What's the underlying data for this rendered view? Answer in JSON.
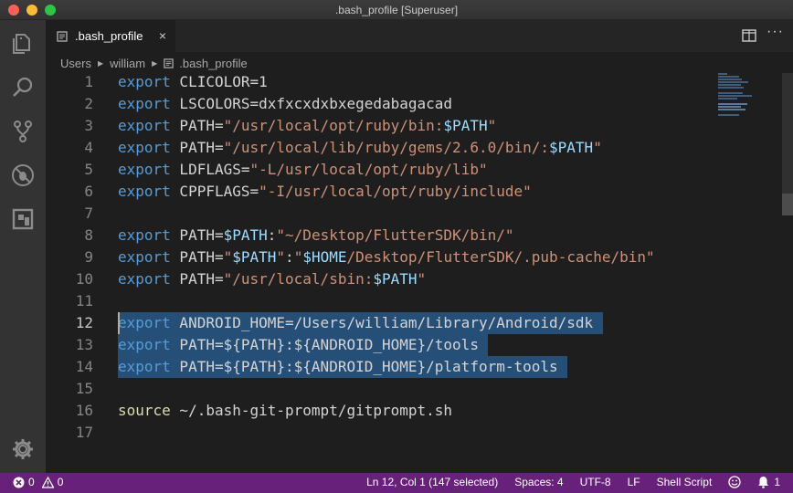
{
  "window": {
    "title": ".bash_profile [Superuser]"
  },
  "tabs": [
    {
      "label": ".bash_profile",
      "close_glyph": "×"
    }
  ],
  "breadcrumb": {
    "items": [
      "Users",
      "william",
      ".bash_profile"
    ]
  },
  "editor": {
    "lines": [
      {
        "num": "1",
        "tokens": [
          [
            "kw",
            "export"
          ],
          [
            "plain",
            " CLICOLOR=1"
          ]
        ]
      },
      {
        "num": "2",
        "tokens": [
          [
            "kw",
            "export"
          ],
          [
            "plain",
            " LSCOLORS=dxfxcxdxbxegedabagacad"
          ]
        ]
      },
      {
        "num": "3",
        "tokens": [
          [
            "kw",
            "export"
          ],
          [
            "plain",
            " PATH="
          ],
          [
            "str",
            "\"/usr/local/opt/ruby/bin:"
          ],
          [
            "var",
            "$PATH"
          ],
          [
            "str",
            "\""
          ]
        ]
      },
      {
        "num": "4",
        "tokens": [
          [
            "kw",
            "export"
          ],
          [
            "plain",
            " PATH="
          ],
          [
            "str",
            "\"/usr/local/lib/ruby/gems/2.6.0/bin/:"
          ],
          [
            "var",
            "$PATH"
          ],
          [
            "str",
            "\""
          ]
        ]
      },
      {
        "num": "5",
        "tokens": [
          [
            "kw",
            "export"
          ],
          [
            "plain",
            " LDFLAGS="
          ],
          [
            "str",
            "\"-L/usr/local/opt/ruby/lib\""
          ]
        ]
      },
      {
        "num": "6",
        "tokens": [
          [
            "kw",
            "export"
          ],
          [
            "plain",
            " CPPFLAGS="
          ],
          [
            "str",
            "\"-I/usr/local/opt/ruby/include\""
          ]
        ]
      },
      {
        "num": "7",
        "tokens": []
      },
      {
        "num": "8",
        "tokens": [
          [
            "kw",
            "export"
          ],
          [
            "plain",
            " PATH="
          ],
          [
            "var",
            "$PATH"
          ],
          [
            "plain",
            ":"
          ],
          [
            "str",
            "\"~/Desktop/FlutterSDK/bin/\""
          ]
        ]
      },
      {
        "num": "9",
        "tokens": [
          [
            "kw",
            "export"
          ],
          [
            "plain",
            " PATH="
          ],
          [
            "str",
            "\""
          ],
          [
            "var",
            "$PATH"
          ],
          [
            "str",
            "\""
          ],
          [
            "plain",
            ":"
          ],
          [
            "str",
            "\""
          ],
          [
            "var",
            "$HOME"
          ],
          [
            "str",
            "/Desktop/FlutterSDK/.pub-cache/bin\""
          ]
        ]
      },
      {
        "num": "10",
        "tokens": [
          [
            "kw",
            "export"
          ],
          [
            "plain",
            " PATH="
          ],
          [
            "str",
            "\"/usr/local/sbin:"
          ],
          [
            "var",
            "$PATH"
          ],
          [
            "str",
            "\""
          ]
        ]
      },
      {
        "num": "11",
        "tokens": []
      },
      {
        "num": "12",
        "tokens": [
          [
            "kw",
            "export"
          ],
          [
            "plain",
            " ANDROID_HOME=/Users/william/Library/Android/sdk"
          ]
        ]
      },
      {
        "num": "13",
        "tokens": [
          [
            "kw",
            "export"
          ],
          [
            "plain",
            " PATH=${PATH}:${ANDROID_HOME}/tools"
          ]
        ]
      },
      {
        "num": "14",
        "tokens": [
          [
            "kw",
            "export"
          ],
          [
            "plain",
            " PATH=${PATH}:${ANDROID_HOME}/platform-tools"
          ]
        ]
      },
      {
        "num": "15",
        "tokens": []
      },
      {
        "num": "16",
        "tokens": [
          [
            "src",
            "source"
          ],
          [
            "plain",
            " ~/.bash-git-prompt/gitprompt.sh"
          ]
        ]
      },
      {
        "num": "17",
        "tokens": []
      }
    ],
    "active_line": "12",
    "selected_lines": [
      "12",
      "13",
      "14"
    ]
  },
  "statusbar": {
    "errors": "0",
    "warnings": "0",
    "cursor_position": "Ln 12, Col 1 (147 selected)",
    "indentation": "Spaces: 4",
    "encoding": "UTF-8",
    "eol": "LF",
    "language": "Shell Script",
    "notifications": "1"
  },
  "icons": {
    "activity": [
      "files-icon",
      "search-icon",
      "source-control-icon",
      "debug-icon",
      "extensions-icon",
      "settings-gear-icon"
    ]
  },
  "colors": {
    "statusbar": "#68217a",
    "keyword": "#569cd6",
    "string": "#ce9178",
    "variable": "#9cdcfe",
    "selection": "#264f78"
  }
}
